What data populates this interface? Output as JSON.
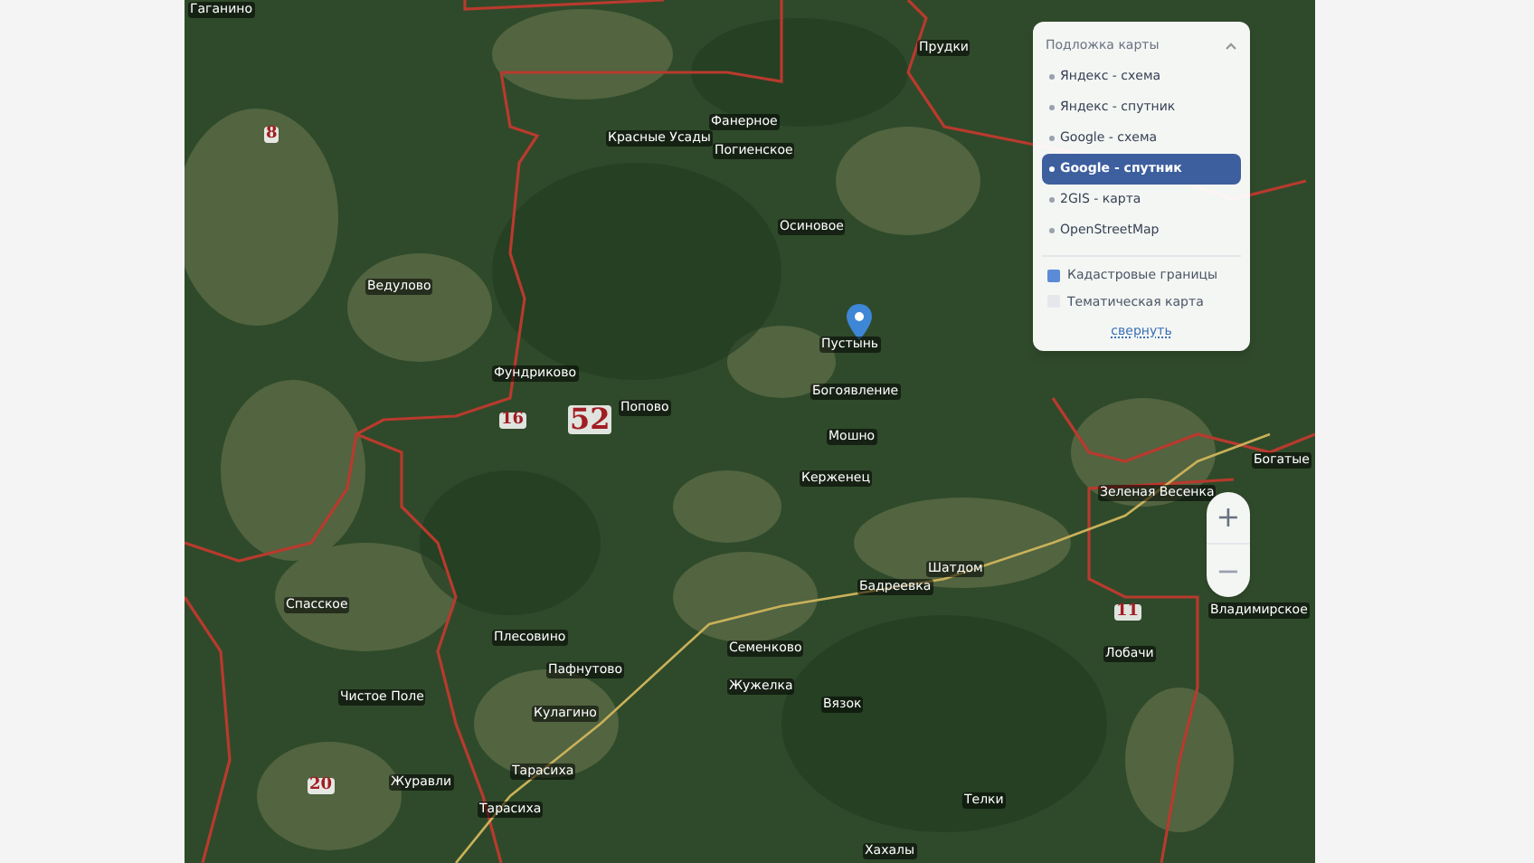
{
  "map": {
    "place_labels": [
      {
        "text": "Гаганино"
      },
      {
        "text": "Красные Усады"
      },
      {
        "text": "Фанерное"
      },
      {
        "text": "Погиенское"
      },
      {
        "text": "Осиновое"
      },
      {
        "text": "Прудки"
      },
      {
        "text": "Ведулово"
      },
      {
        "text": "Фундриково"
      },
      {
        "text": "Попово"
      },
      {
        "text": "Пустынь"
      },
      {
        "text": "Богоявление"
      },
      {
        "text": "Мошно"
      },
      {
        "text": "Керженец"
      },
      {
        "text": "Спасское"
      },
      {
        "text": "Плесовино"
      },
      {
        "text": "Пафнутово"
      },
      {
        "text": "Кулагино"
      },
      {
        "text": "Чистое Поле"
      },
      {
        "text": "Журавли"
      },
      {
        "text": "Тарасиха"
      },
      {
        "text": "Тарасиха"
      },
      {
        "text": "Семенково"
      },
      {
        "text": "Жужелка"
      },
      {
        "text": "Вязок"
      },
      {
        "text": "Бадреевка"
      },
      {
        "text": "Шатдом"
      },
      {
        "text": "Зеленая Весенка"
      },
      {
        "text": "Богатые"
      },
      {
        "text": "Лобачи"
      },
      {
        "text": "Владимирское"
      },
      {
        "text": "Телки"
      },
      {
        "text": "Хахалы"
      }
    ],
    "region_numbers": [
      {
        "text": "8"
      },
      {
        "text": "16"
      },
      {
        "text": "52"
      },
      {
        "text": "20"
      },
      {
        "text": "11"
      }
    ]
  },
  "layers_panel": {
    "title": "Подложка карты",
    "layers": [
      {
        "label": "Яндекс - схема",
        "selected": false
      },
      {
        "label": "Яндекс - спутник",
        "selected": false
      },
      {
        "label": "Google - схема",
        "selected": false
      },
      {
        "label": "Google - спутник",
        "selected": true
      },
      {
        "label": "2GIS - карта",
        "selected": false
      },
      {
        "label": "OpenStreetMap",
        "selected": false
      }
    ],
    "overlays": [
      {
        "label": "Кадастровые границы",
        "checked": true
      },
      {
        "label": "Тематическая карта",
        "checked": false
      }
    ],
    "collapse_link": "свернуть"
  },
  "zoom_controls": {
    "zoom_in": "+",
    "zoom_out": "−"
  }
}
